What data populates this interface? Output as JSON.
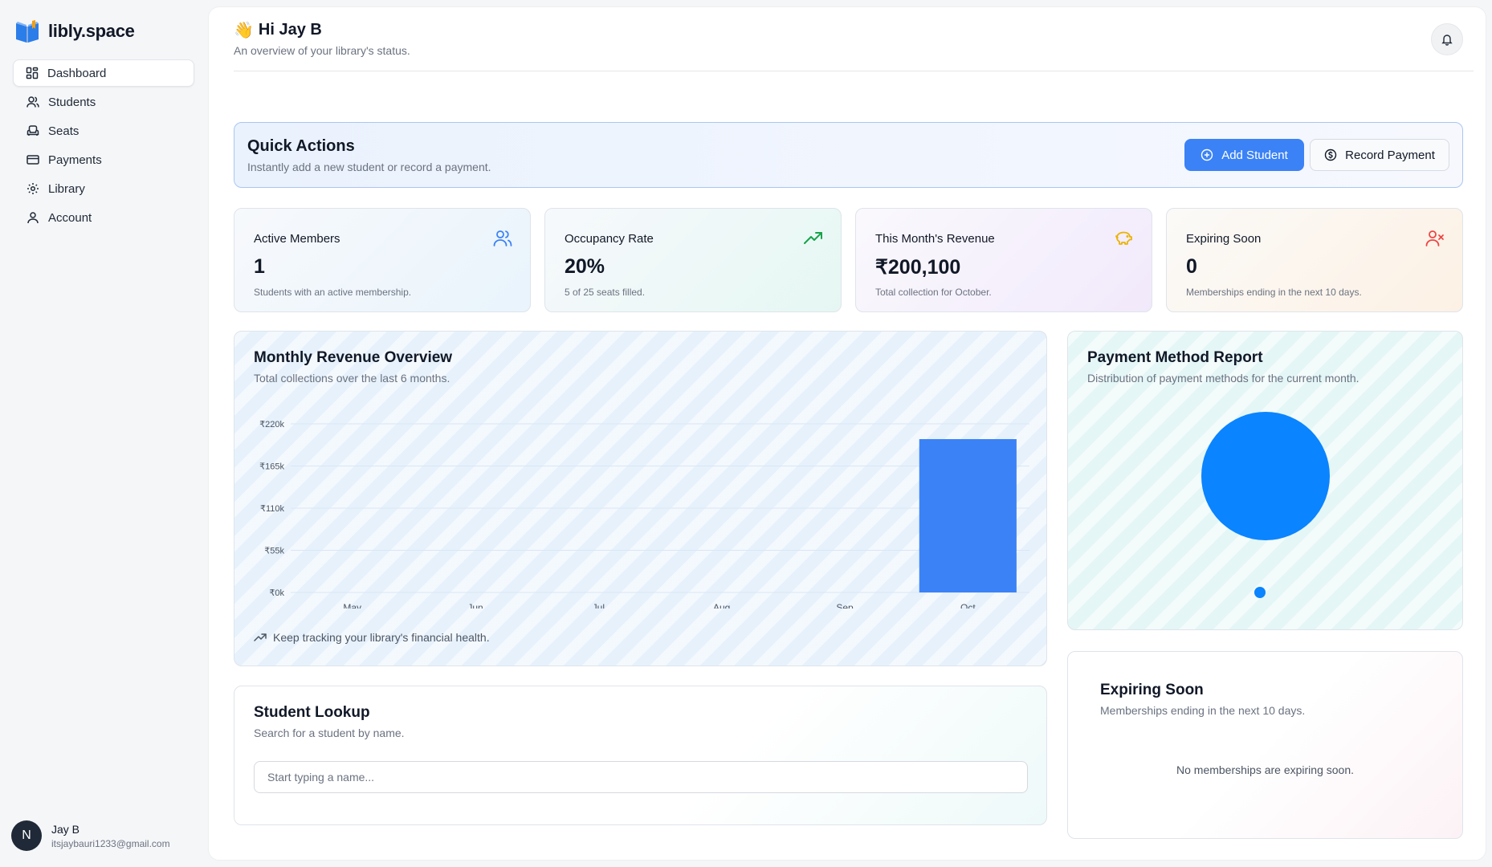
{
  "app": {
    "name": "libly.space"
  },
  "sidebar": {
    "items": [
      {
        "label": "Dashboard",
        "icon": "dashboard-icon",
        "active": true
      },
      {
        "label": "Students",
        "icon": "users-icon"
      },
      {
        "label": "Seats",
        "icon": "armchair-icon"
      },
      {
        "label": "Payments",
        "icon": "credit-card-icon"
      },
      {
        "label": "Library",
        "icon": "gear-icon"
      },
      {
        "label": "Account",
        "icon": "user-icon"
      }
    ]
  },
  "user": {
    "initial": "N",
    "name": "Jay B",
    "email": "itsjaybauri1233@gmail.com"
  },
  "header": {
    "wave": "👋",
    "greeting": "Hi Jay B",
    "subtitle": "An overview of your library's status."
  },
  "quick_actions": {
    "title": "Quick Actions",
    "subtitle": "Instantly add a new student or record a payment.",
    "add_student_label": "Add Student",
    "record_payment_label": "Record Payment"
  },
  "stats": [
    {
      "title": "Active Members",
      "value": "1",
      "sub": "Students with an active membership.",
      "icon": "users-icon",
      "color": "#3b82f6"
    },
    {
      "title": "Occupancy Rate",
      "value": "20%",
      "sub": "5 of 25 seats filled.",
      "icon": "trending-up-icon",
      "color": "#16a34a"
    },
    {
      "title": "This Month's Revenue",
      "value": "₹200,100",
      "sub": "Total collection for October.",
      "icon": "piggy-bank-icon",
      "color": "#eab308"
    },
    {
      "title": "Expiring Soon",
      "value": "0",
      "sub": "Memberships ending in the next 10 days.",
      "icon": "user-x-icon",
      "color": "#ef4444"
    }
  ],
  "revenue": {
    "title": "Monthly Revenue Overview",
    "subtitle": "Total collections over the last 6 months.",
    "footer": "Keep tracking your library's financial health."
  },
  "payment_report": {
    "title": "Payment Method Report",
    "subtitle": "Distribution of payment methods for the current month."
  },
  "lookup": {
    "title": "Student Lookup",
    "subtitle": "Search for a student by name.",
    "placeholder": "Start typing a name..."
  },
  "expiring": {
    "title": "Expiring Soon",
    "subtitle": "Memberships ending in the next 10 days.",
    "empty": "No memberships are expiring soon."
  },
  "colors": {
    "accent": "#3b82f6",
    "pie": "#0a84ff"
  },
  "chart_data": [
    {
      "type": "bar",
      "categories": [
        "May",
        "Jun",
        "Jul",
        "Aug",
        "Sep",
        "Oct"
      ],
      "values": [
        0,
        0,
        0,
        0,
        0,
        200100
      ],
      "ylim": [
        0,
        220000
      ],
      "yticks": [
        0,
        55000,
        110000,
        165000,
        220000
      ],
      "ytick_labels": [
        "₹0k",
        "₹55k",
        "₹110k",
        "₹165k",
        "₹220k"
      ],
      "grid": true,
      "color": "#3b82f6"
    },
    {
      "type": "pie",
      "values": [
        100
      ],
      "colors": [
        "#0a84ff"
      ],
      "legend": "bottom"
    }
  ]
}
